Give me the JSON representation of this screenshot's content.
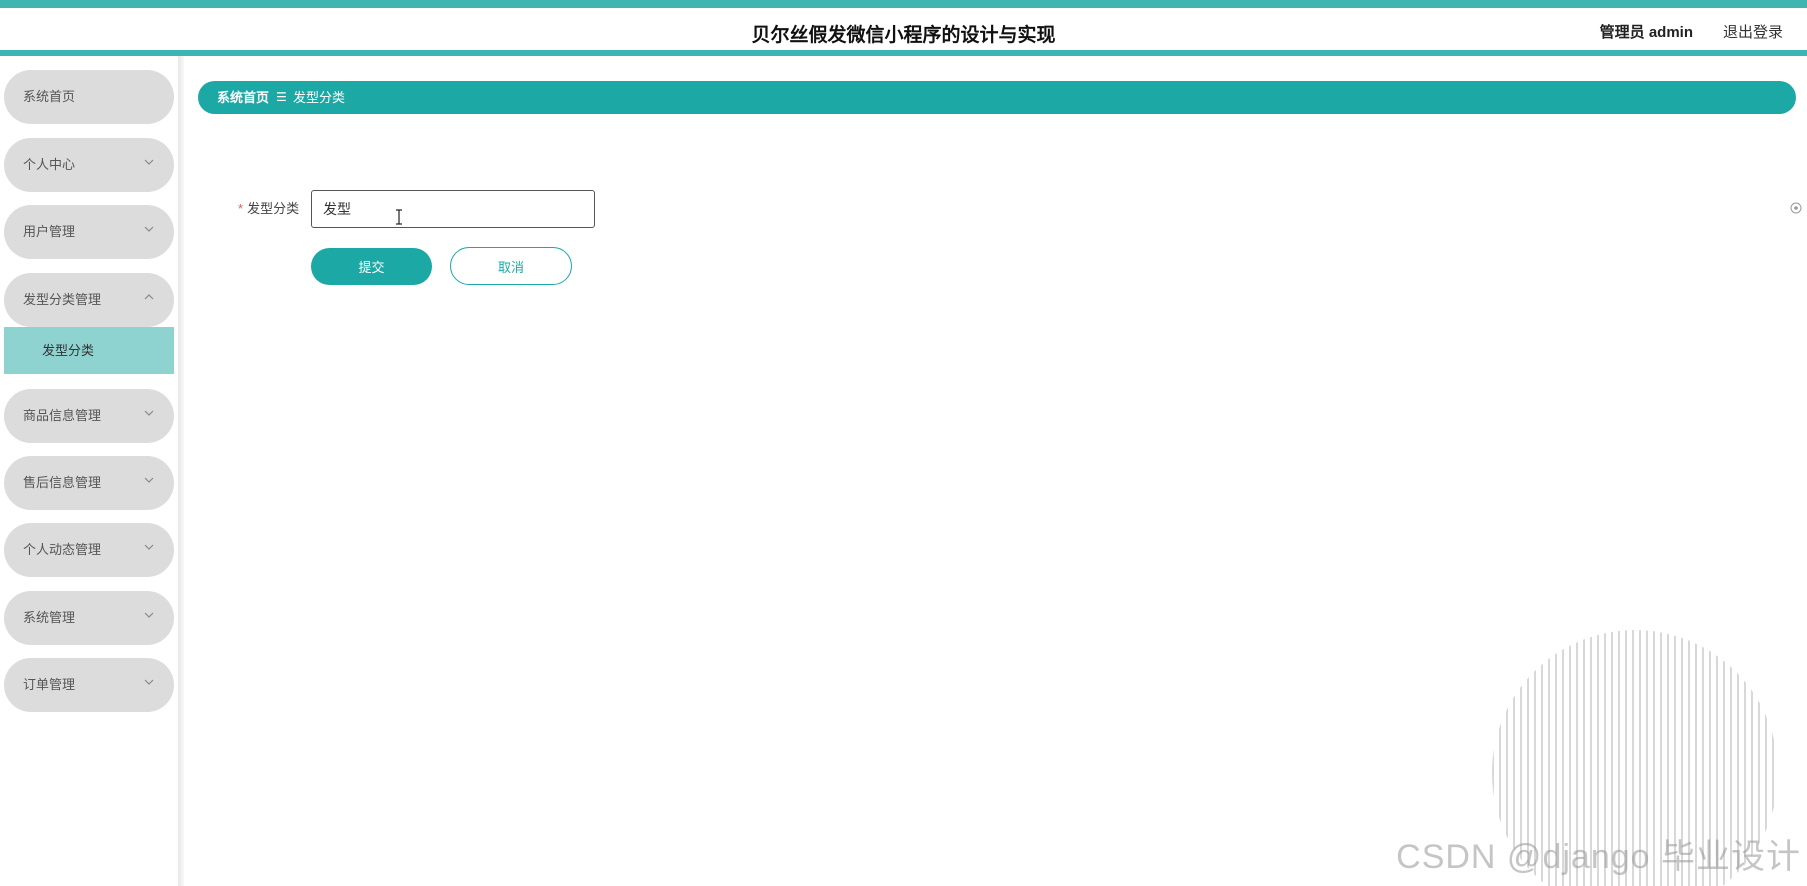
{
  "header": {
    "title": "贝尔丝假发微信小程序的设计与实现",
    "user_label": "管理员 admin",
    "logout_label": "退出登录"
  },
  "sidebar": {
    "items": [
      {
        "label": "系统首页"
      },
      {
        "label": "个人中心"
      },
      {
        "label": "用户管理"
      },
      {
        "label": "发型分类管理",
        "expanded": true
      },
      {
        "label": "商品信息管理"
      },
      {
        "label": "售后信息管理"
      },
      {
        "label": "个人动态管理"
      },
      {
        "label": "系统管理"
      },
      {
        "label": "订单管理"
      }
    ],
    "active_sub": {
      "label": "发型分类"
    }
  },
  "breadcrumb": {
    "home": "系统首页",
    "separator": "☰",
    "current": "发型分类"
  },
  "form": {
    "field_label": "发型分类",
    "required_mark": "*",
    "field_value": "发型",
    "submit_label": "提交",
    "cancel_label": "取消"
  },
  "watermark": "CSDN @django 毕业设计",
  "colors": {
    "accent": "#1ca8a5",
    "header_accent": "#3fb5b1",
    "sub_active": "#8fd3d1",
    "nav_item_bg": "#dcdcdc"
  },
  "icons": {
    "nav_chevron": "chevron-down-icon",
    "nav_expanded": "chevron-up-icon",
    "settings": "circle-dot-icon"
  }
}
